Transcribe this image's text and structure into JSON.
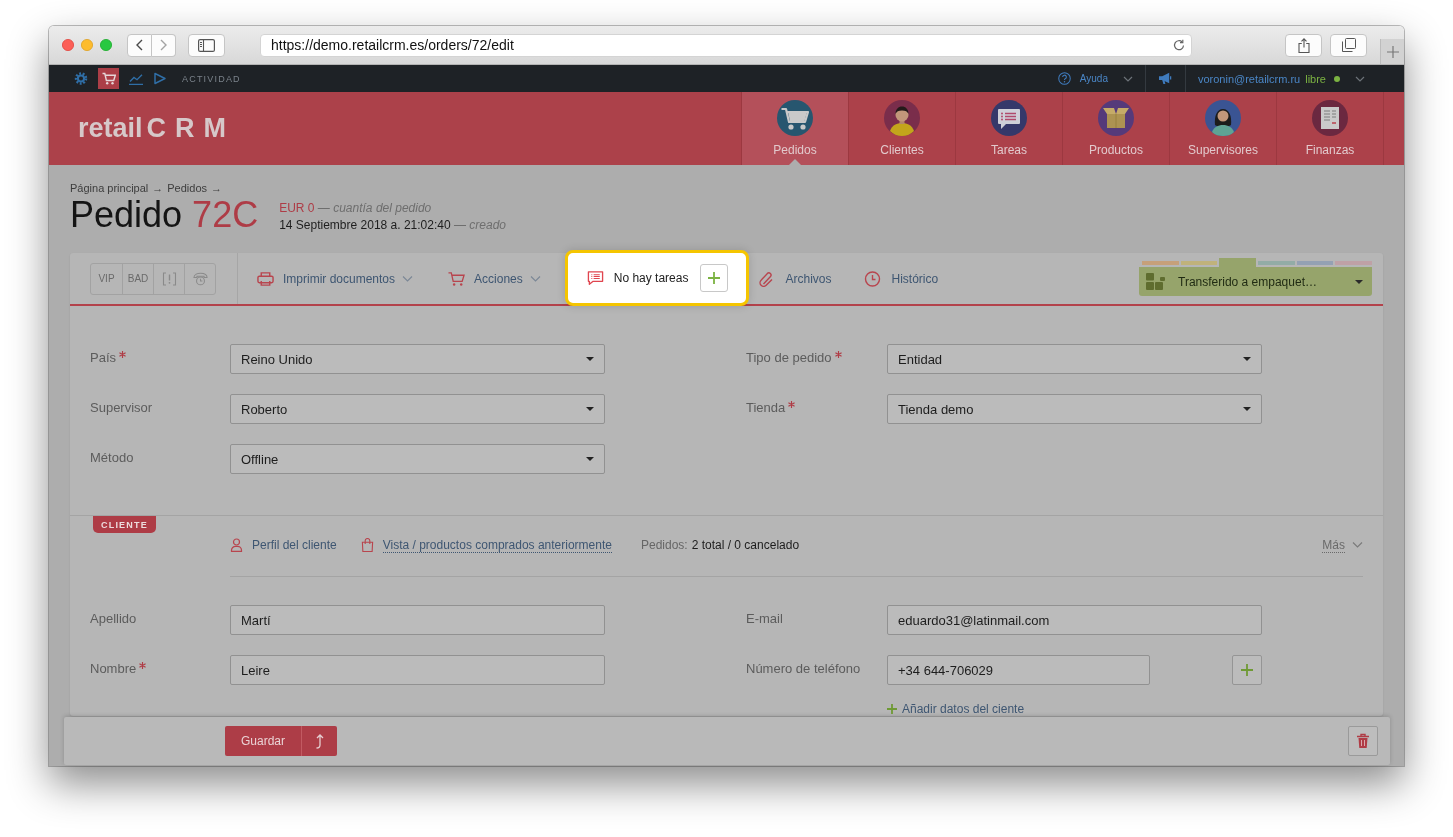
{
  "browser": {
    "url": "https://demo.retailcrm.es/orders/72/edit"
  },
  "top_bar": {
    "modules": [
      {
        "kind": "settings",
        "selected": false
      },
      {
        "kind": "cart",
        "selected": true
      },
      {
        "kind": "chart",
        "selected": false
      },
      {
        "kind": "play",
        "selected": false
      }
    ],
    "activity": "ACTIVIDAD",
    "help": "Ayuda",
    "user": "voronin@retailcrm.ru",
    "user_status": "libre"
  },
  "header": {
    "logo": {
      "word": "retail",
      "mark": "CRM"
    },
    "nav": [
      {
        "label": "Pedidos",
        "kind": "cart",
        "selected": true
      },
      {
        "label": "Clientes",
        "kind": "man",
        "selected": false
      },
      {
        "label": "Tareas",
        "kind": "chat",
        "selected": false
      },
      {
        "label": "Productos",
        "kind": "box",
        "selected": false
      },
      {
        "label": "Supervisores",
        "kind": "woman",
        "selected": false
      },
      {
        "label": "Finanzas",
        "kind": "document",
        "selected": false
      }
    ]
  },
  "order": {
    "breadcrumb": [
      "Página principal",
      "Pedidos"
    ],
    "separator": "→",
    "title": "Pedido",
    "number": "72C",
    "amount": "EUR 0",
    "amount_note": "— cuantía del pedido",
    "created": "14 Septiembre 2018 a. 21:02:40",
    "created_note": "— creado"
  },
  "toolbar": {
    "tags": [
      {
        "kind": "text",
        "label": "VIP",
        "selected": false
      },
      {
        "kind": "text",
        "label": "BAD",
        "selected": false
      },
      {
        "kind": "alert",
        "selected": false
      },
      {
        "kind": "phone",
        "selected": false
      }
    ],
    "actions": [
      {
        "kind": "print",
        "label": "Imprimir documentos",
        "dropdown": true
      },
      {
        "kind": "cart",
        "label": "Acciones",
        "dropdown": true
      }
    ],
    "tasks": {
      "label": "No hay tareas",
      "highlighted": true
    },
    "links": [
      {
        "kind": "clip",
        "label": "Archivos"
      },
      {
        "kind": "clock",
        "label": "Histórico"
      }
    ],
    "status": {
      "label": "Transferido a empaquet…",
      "steps": [
        {
          "color": "#c6a07a",
          "selected": false
        },
        {
          "color": "#c0b27b",
          "selected": false
        },
        {
          "color": "#96a46b",
          "selected": true
        },
        {
          "color": "#93aca6",
          "selected": false
        },
        {
          "color": "#94a1b3",
          "selected": false
        },
        {
          "color": "#bfa1a6",
          "selected": false
        }
      ]
    }
  },
  "order_form": {
    "left": [
      {
        "label": "País",
        "required": true,
        "value": "Reino Unido"
      },
      {
        "label": "Supervisor",
        "required": false,
        "value": "Roberto"
      },
      {
        "label": "Método",
        "required": false,
        "value": "Offline"
      }
    ],
    "right": [
      {
        "label": "Tipo de pedido",
        "required": true,
        "value": "Entidad"
      },
      {
        "label": "Tienda",
        "required": true,
        "value": "Tienda demo"
      }
    ]
  },
  "client": {
    "tag": "CLIENTE",
    "links": [
      {
        "kind": "profile",
        "label": "Perfil del cliente"
      },
      {
        "kind": "purchases",
        "label": "Vista / productos comprados anteriormente"
      }
    ],
    "orders_label": "Pedidos:",
    "orders_value": "2 total / 0 cancelado",
    "more": "Más",
    "left": [
      {
        "label": "Apellido",
        "required": false,
        "value": "Martí"
      },
      {
        "label": "Nombre",
        "required": true,
        "value": "Leire"
      }
    ],
    "right": [
      {
        "label": "E-mail",
        "required": false,
        "value": "eduardo31@latinmail.com",
        "add_button": false
      },
      {
        "label": "Número de teléfono",
        "required": false,
        "value": "+34 644-706029",
        "add_button": true
      }
    ],
    "add_data": "Añadir datos del ciente"
  },
  "footer": {
    "save": "Guardar"
  }
}
